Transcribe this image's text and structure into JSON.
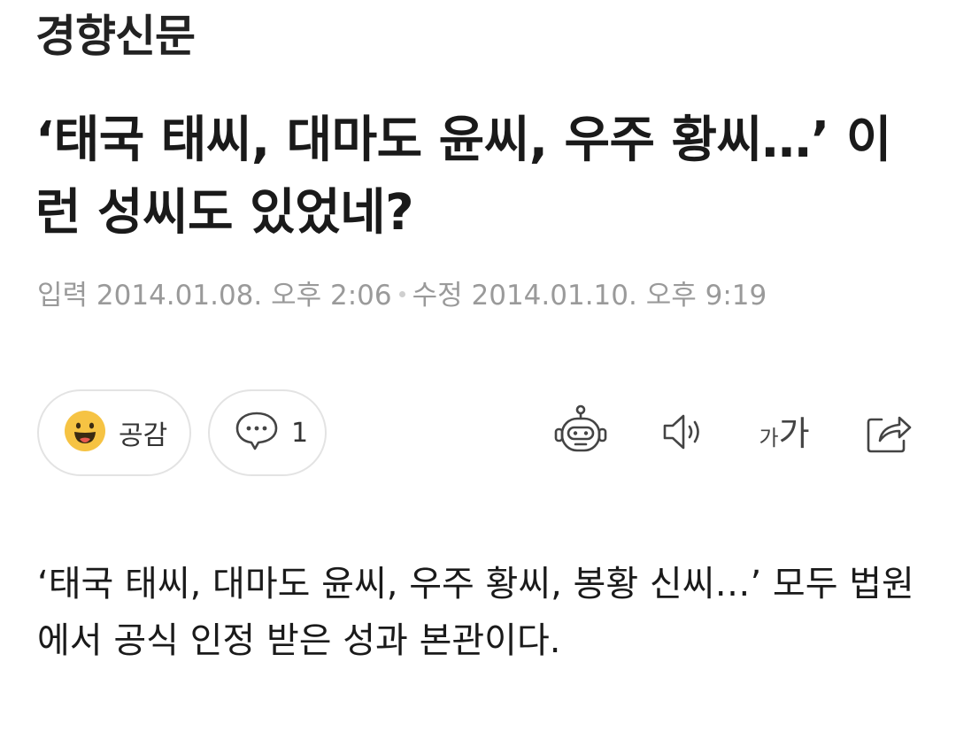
{
  "header": {
    "logo": "경향신문"
  },
  "article": {
    "title": "‘태국 태씨, 대마도 윤씨, 우주 황씨…’ 이런 성씨도 있었네?",
    "meta": {
      "input_label": "입력 2014.01.08. 오후 2:06",
      "edit_label": "수정 2014.01.10. 오후 9:19"
    },
    "body": "‘태국 태씨, 대마도 윤씨, 우주 황씨, 봉황 신씨…’ 모두 법원에서 공식 인정 받은 성과 본관이다."
  },
  "reactions": {
    "like_label": "공감",
    "like_icon": "smiley-face-icon",
    "comment_count": "1",
    "comment_icon": "speech-bubble-icon"
  },
  "toolbar": {
    "robot_icon": "robot-icon",
    "audio_icon": "speaker-icon",
    "font_size_icon": "font-size-icon",
    "font_small": "가",
    "font_large": "가",
    "share_icon": "share-icon"
  },
  "colors": {
    "meta_text": "#9a9a9a",
    "pill_border": "#e3e3e3",
    "smiley": "#f6c343"
  }
}
